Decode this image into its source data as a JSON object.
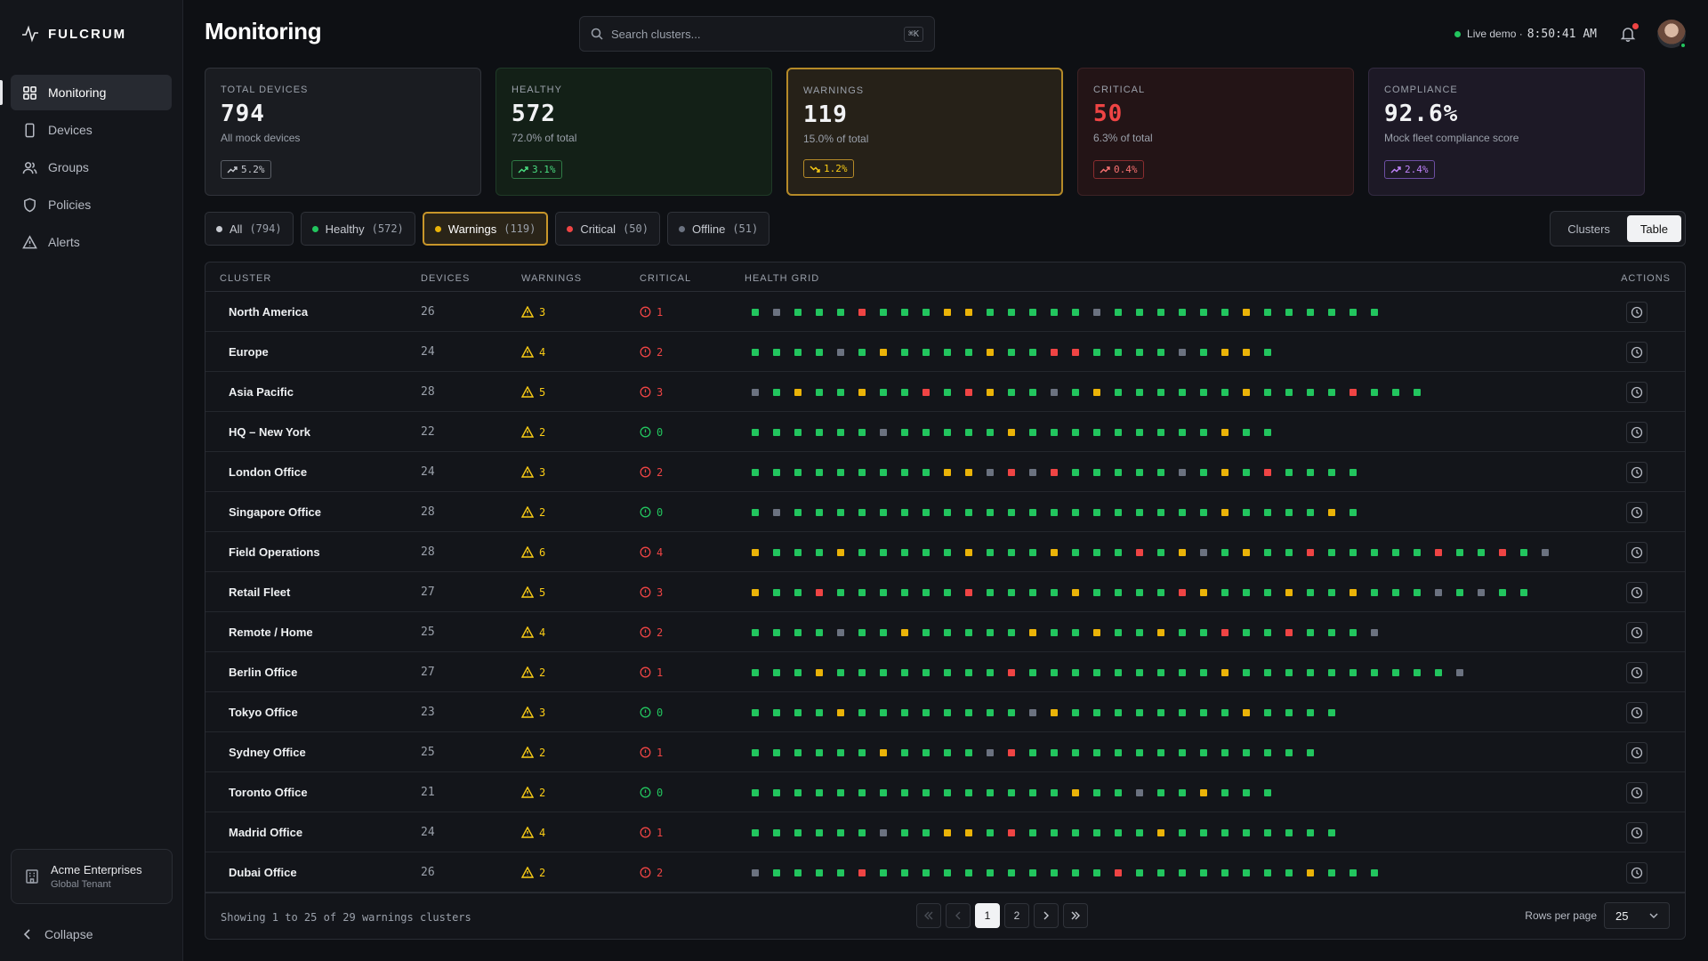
{
  "app": {
    "brand": "FULCRUM"
  },
  "sidebar": {
    "items": [
      {
        "label": "Monitoring",
        "icon": "grid-icon",
        "active": true
      },
      {
        "label": "Devices",
        "icon": "device-icon"
      },
      {
        "label": "Groups",
        "icon": "users-icon"
      },
      {
        "label": "Policies",
        "icon": "shield-icon"
      },
      {
        "label": "Alerts",
        "icon": "alert-triangle-icon"
      }
    ],
    "tenant": {
      "name": "Acme Enterprises",
      "subtitle": "Global Tenant"
    },
    "collapse_label": "Collapse"
  },
  "header": {
    "title": "Monitoring",
    "search_placeholder": "Search clusters...",
    "search_shortcut": "⌘K",
    "live_label": "Live demo ·",
    "clock": "8:50:41 AM"
  },
  "stats": [
    {
      "label": "TOTAL DEVICES",
      "value": "794",
      "sub": "All mock devices",
      "trend": "5.2%",
      "dir": "up"
    },
    {
      "label": "HEALTHY",
      "value": "572",
      "sub": "72.0% of total",
      "trend": "3.1%",
      "dir": "up"
    },
    {
      "label": "WARNINGS",
      "value": "119",
      "sub": "15.0% of total",
      "trend": "1.2%",
      "dir": "down"
    },
    {
      "label": "CRITICAL",
      "value": "50",
      "sub": "6.3% of total",
      "trend": "0.4%",
      "dir": "up"
    },
    {
      "label": "COMPLIANCE",
      "value": "92.6%",
      "sub": "Mock fleet compliance score",
      "trend": "2.4%",
      "dir": "up"
    }
  ],
  "filters": [
    {
      "label": "All",
      "count": "(794)",
      "color": "#c7cad1"
    },
    {
      "label": "Healthy",
      "count": "(572)",
      "color": "#22c55e"
    },
    {
      "label": "Warnings",
      "count": "(119)",
      "color": "#eab308",
      "active": true
    },
    {
      "label": "Critical",
      "count": "(50)",
      "color": "#ef4444"
    },
    {
      "label": "Offline",
      "count": "(51)",
      "color": "#6b7280"
    }
  ],
  "view_toggle": {
    "options": [
      "Clusters",
      "Table"
    ],
    "active": "Table"
  },
  "table": {
    "columns": [
      "CLUSTER",
      "DEVICES",
      "WARNINGS",
      "CRITICAL",
      "HEALTH GRID",
      "ACTIONS"
    ],
    "rows": [
      {
        "name": "North America",
        "devices": "26",
        "warnings": "3",
        "critical": "1",
        "grid": "gogggrgggyygggggoggggggygggggg"
      },
      {
        "name": "Europe",
        "devices": "24",
        "warnings": "4",
        "critical": "2",
        "grid": "ggggogyggggyggrrggggogyyg"
      },
      {
        "name": "Asia Pacific",
        "devices": "28",
        "warnings": "5",
        "critical": "3",
        "grid": "ogyggyggrgryggogyggggggyggggrggg"
      },
      {
        "name": "HQ – New York",
        "devices": "22",
        "warnings": "2",
        "critical": "0",
        "grid": "ggggggogggggygggggggggygg"
      },
      {
        "name": "London Office",
        "devices": "24",
        "warnings": "3",
        "critical": "2",
        "grid": "gggggggggyyororgggggogygrgggg"
      },
      {
        "name": "Singapore Office",
        "devices": "28",
        "warnings": "2",
        "critical": "0",
        "grid": "goggggggggggggggggggggyggggyg"
      },
      {
        "name": "Field Operations",
        "devices": "28",
        "warnings": "6",
        "critical": "4",
        "grid": "ygggygggggygggygggrgyogyggrgggggrggrgo"
      },
      {
        "name": "Retail Fleet",
        "devices": "27",
        "warnings": "5",
        "critical": "3",
        "grid": "yggrggggggrggggyggggrygggyggygggogogg"
      },
      {
        "name": "Remote / Home",
        "devices": "25",
        "warnings": "4",
        "critical": "2",
        "grid": "ggggoggygggggyggyggyggrggrgggo"
      },
      {
        "name": "Berlin Office",
        "devices": "27",
        "warnings": "2",
        "critical": "1",
        "grid": "gggyggggggggrgggggggggyggggggggggo"
      },
      {
        "name": "Tokyo Office",
        "devices": "23",
        "warnings": "3",
        "critical": "0",
        "grid": "ggggyggggggggoyggggggggygggg"
      },
      {
        "name": "Sydney Office",
        "devices": "25",
        "warnings": "2",
        "critical": "1",
        "grid": "ggggggyggggorgggggggggggggg"
      },
      {
        "name": "Toronto Office",
        "devices": "21",
        "warnings": "2",
        "critical": "0",
        "grid": "gggggggggggggggyggoggyggg"
      },
      {
        "name": "Madrid Office",
        "devices": "24",
        "warnings": "4",
        "critical": "1",
        "grid": "ggggggoggyygrggggggygggggggg"
      },
      {
        "name": "Dubai Office",
        "devices": "26",
        "warnings": "2",
        "critical": "2",
        "grid": "oggggrgggggggggggrggggggggyggg"
      }
    ]
  },
  "footer": {
    "showing": "Showing 1 to 25 of 29 warnings clusters",
    "pages": [
      "1",
      "2"
    ],
    "rows_per_page_label": "Rows per page",
    "rows_per_page": "25"
  },
  "colors": {
    "g": "#22c55e",
    "y": "#eab308",
    "r": "#ef4444",
    "o": "#6b7280"
  }
}
